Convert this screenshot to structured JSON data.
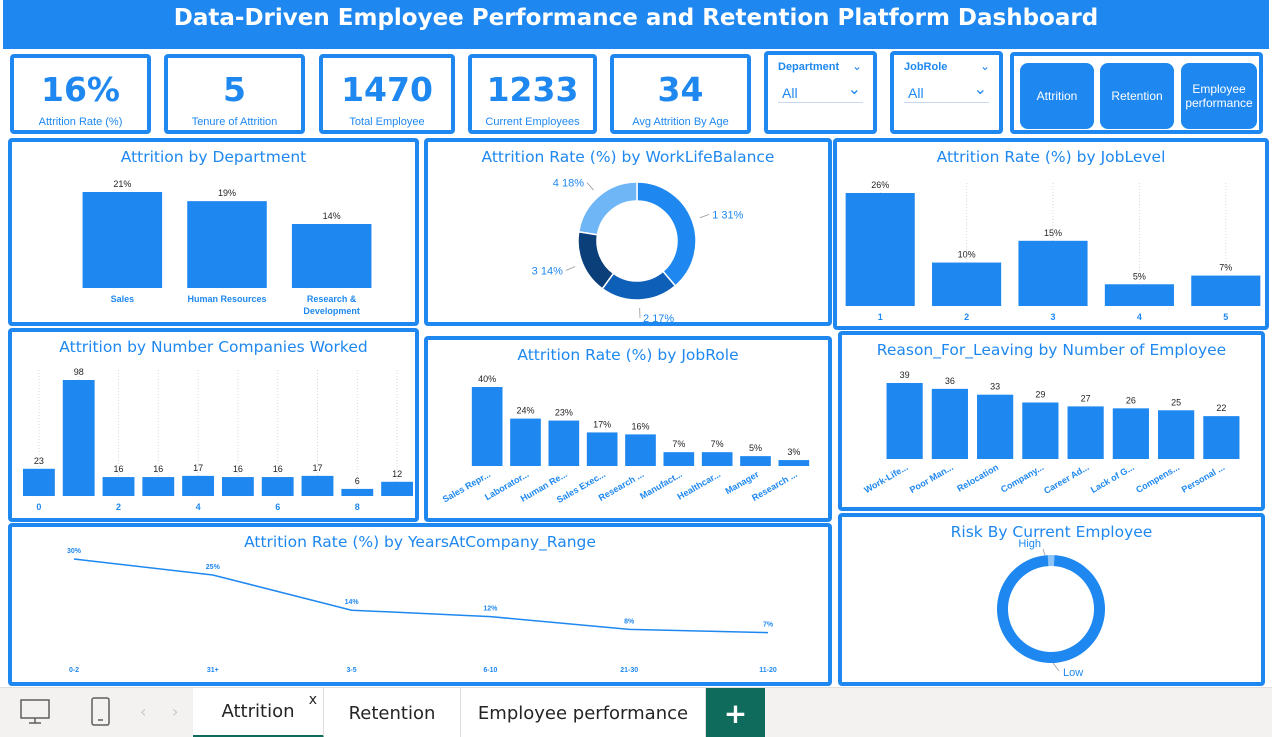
{
  "header": {
    "title": "Data-Driven Employee Performance and Retention Platform Dashboard"
  },
  "kpis": [
    {
      "value": "16%",
      "label": "Attrition Rate (%)"
    },
    {
      "value": "5",
      "label": "Tenure of Attrition"
    },
    {
      "value": "1470",
      "label": "Total Employee"
    },
    {
      "value": "1233",
      "label": "Current Employees"
    },
    {
      "value": "34",
      "label": "Avg Attrition By Age"
    }
  ],
  "slicers": [
    {
      "title": "Department",
      "value": "All"
    },
    {
      "title": "JobRole",
      "value": "All"
    }
  ],
  "nav_buttons": [
    "Attrition",
    "Retention",
    "Employee performance"
  ],
  "chart_data": [
    {
      "id": "dept",
      "type": "bar",
      "title": "Attrition by Department",
      "categories": [
        "Sales",
        "Human Resources",
        "Research & Development"
      ],
      "values": [
        21,
        19,
        14
      ],
      "labels": [
        "21%",
        "19%",
        "14%"
      ]
    },
    {
      "id": "wlb",
      "type": "pie",
      "title": "Attrition Rate (%) by WorkLifeBalance",
      "categories": [
        "1",
        "2",
        "3",
        "4"
      ],
      "values": [
        31,
        17,
        14,
        18
      ],
      "labels": [
        "1 31%",
        "2 17%",
        "3 14%",
        "4 18%"
      ],
      "colors": [
        "#1e88f0",
        "#0d5fb8",
        "#0a3f7a",
        "#6fb6f7"
      ]
    },
    {
      "id": "joblevel",
      "type": "bar",
      "title": "Attrition Rate (%) by JobLevel",
      "categories": [
        "1",
        "2",
        "3",
        "4",
        "5"
      ],
      "values": [
        26,
        10,
        15,
        5,
        7
      ],
      "labels": [
        "26%",
        "10%",
        "15%",
        "5%",
        "7%"
      ]
    },
    {
      "id": "companies",
      "type": "bar",
      "title": "Attrition by Number Companies Worked",
      "categories": [
        "0",
        "1",
        "2",
        "3",
        "4",
        "5",
        "6",
        "7",
        "8",
        "9"
      ],
      "tick_labels": [
        "0",
        "",
        "2",
        "",
        "4",
        "",
        "6",
        "",
        "8",
        ""
      ],
      "values": [
        23,
        98,
        16,
        16,
        17,
        16,
        16,
        17,
        6,
        12
      ]
    },
    {
      "id": "jobrole",
      "type": "bar",
      "title": "Attrition Rate (%) by JobRole",
      "categories": [
        "Sales Repr...",
        "Laborator...",
        "Human Re...",
        "Sales Exec...",
        "Research ...",
        "Manufact...",
        "Healthcar...",
        "Manager",
        "Research ..."
      ],
      "values": [
        40,
        24,
        23,
        17,
        16,
        7,
        7,
        5,
        3
      ],
      "labels": [
        "40%",
        "24%",
        "23%",
        "17%",
        "16%",
        "7%",
        "7%",
        "5%",
        "3%"
      ]
    },
    {
      "id": "reason",
      "type": "bar",
      "title": "Reason_For_Leaving by Number of Employee",
      "categories": [
        "Work-Life...",
        "Poor Man...",
        "Relocation",
        "Company...",
        "Career Ad...",
        "Lack of G...",
        "Compens...",
        "Personal ..."
      ],
      "values": [
        39,
        36,
        33,
        29,
        27,
        26,
        25,
        22
      ]
    },
    {
      "id": "years",
      "type": "line",
      "title": "Attrition Rate (%) by YearsAtCompany_Range",
      "categories": [
        "0-2",
        "31+",
        "3-5",
        "6-10",
        "21-30",
        "11-20"
      ],
      "values": [
        30,
        25,
        14,
        12,
        8,
        7
      ],
      "labels": [
        "30%",
        "25%",
        "14%",
        "12%",
        "8%",
        "7%"
      ]
    },
    {
      "id": "risk",
      "type": "pie",
      "title": "Risk By Current Employee",
      "categories": [
        "High",
        "Low"
      ],
      "values": [
        2,
        98
      ],
      "colors": [
        "#8cc4f8",
        "#1e88f0"
      ]
    }
  ],
  "tabs": [
    {
      "label": "Attrition",
      "close": "x"
    },
    {
      "label": "Retention"
    },
    {
      "label": "Employee performance"
    }
  ],
  "add_tab": "+"
}
